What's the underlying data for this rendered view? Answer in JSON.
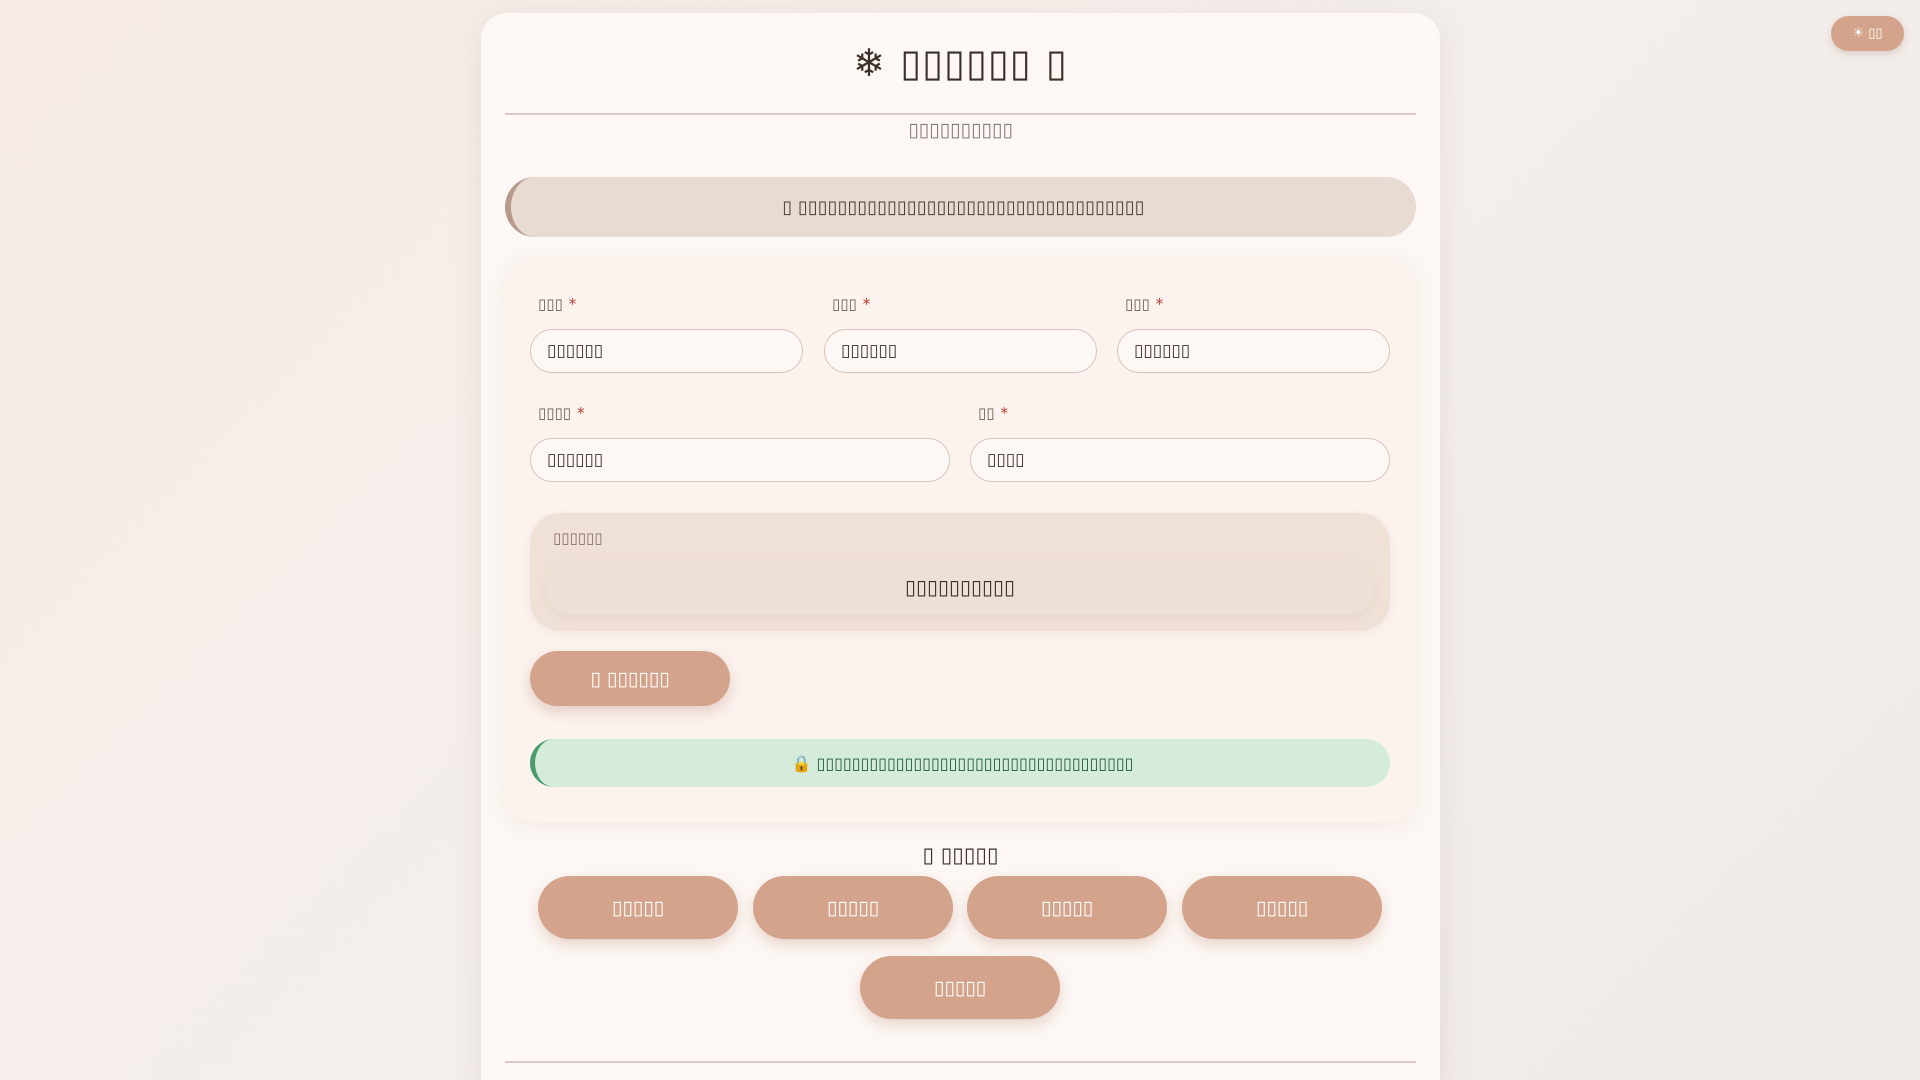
{
  "header": {
    "theme_toggle_label": "☀ ▯▯",
    "title": "❄ ▯▯▯▯▯▯ ▯",
    "subtitle": "▯▯▯▯▯▯▯▯▯▯"
  },
  "notice": {
    "text": "▯ ▯▯▯▯▯▯▯▯▯▯▯▯▯▯▯▯▯▯▯▯▯▯▯▯▯▯▯▯▯▯▯▯▯▯▯"
  },
  "form": {
    "fields": [
      {
        "label": "▯▯▯",
        "required_mark": "*",
        "value": "▯▯▯▯▯▯"
      },
      {
        "label": "▯▯▯",
        "required_mark": "*",
        "value": "▯▯▯▯▯▯"
      },
      {
        "label": "▯▯▯",
        "required_mark": "*",
        "value": "▯▯▯▯▯▯"
      },
      {
        "label": "▯▯▯▯",
        "required_mark": "*",
        "value": "▯▯▯▯▯▯"
      },
      {
        "label": "▯▯",
        "required_mark": "*",
        "value": "▯▯▯▯"
      }
    ],
    "result": {
      "label": "▯▯▯▯▯▯",
      "value": "▯▯▯▯▯▯▯▯▯▯"
    },
    "primary_button_label": "▯ ▯▯▯▯▯▯",
    "privacy_text": "🔒 ▯▯▯▯▯▯▯▯▯▯▯▯▯▯▯▯▯▯▯▯▯▯▯▯▯▯▯▯▯▯▯▯▯▯▯▯"
  },
  "related": {
    "title": "▯ ▯▯▯▯▯",
    "tools": [
      "▯▯▯▯▯",
      "▯▯▯▯▯",
      "▯▯▯▯▯",
      "▯▯▯▯▯",
      "▯▯▯▯▯"
    ]
  },
  "colors": {
    "accent": "#d4a38b",
    "required": "#c0392b",
    "privacy_bg": "#d5ecdd",
    "privacy_text": "#1e5a35"
  },
  "icons": {
    "theme_toggle": "sun-icon",
    "title": "snowflake-icon",
    "privacy": "lock-icon"
  }
}
